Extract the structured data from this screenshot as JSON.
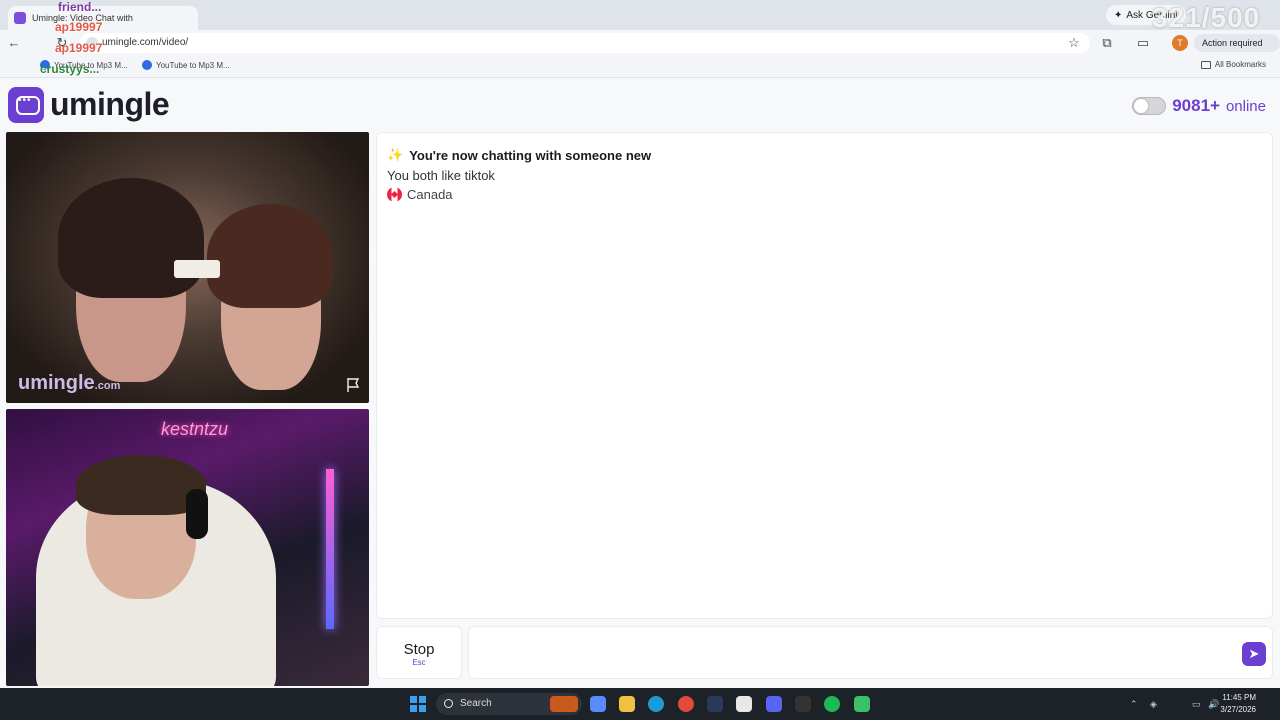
{
  "browser": {
    "tab_title": "Umingle: Video Chat with",
    "ask_gemini": "Ask Gemini",
    "url": "umingle.com/video/",
    "profile_initial": "T",
    "action_required": "Action required",
    "bookmarks": [
      "YouTube to Mp3 M...",
      "YouTube to Mp3 M..."
    ],
    "all_bookmarks": "All Bookmarks"
  },
  "stream_overlay": {
    "counter": "321/500",
    "chat_lines": [
      "friend...",
      "ap19997",
      "ap19997",
      "crustyys..."
    ]
  },
  "site": {
    "logo_text": "umingle",
    "online_count": "9081+",
    "online_label": "online"
  },
  "video": {
    "watermark": "umingle",
    "watermark_suffix": ".com",
    "neon_sign": "kestntzu"
  },
  "chat": {
    "title": "You're now chatting with someone new",
    "interest": "You both like tiktok",
    "country": "Canada",
    "stop_label": "Stop",
    "stop_hint": "Esc",
    "input_placeholder": ""
  },
  "taskbar": {
    "search": "Search",
    "time": "11:45 PM",
    "date": "3/27/2026"
  },
  "colors": {
    "brand": "#6b3fd1"
  }
}
